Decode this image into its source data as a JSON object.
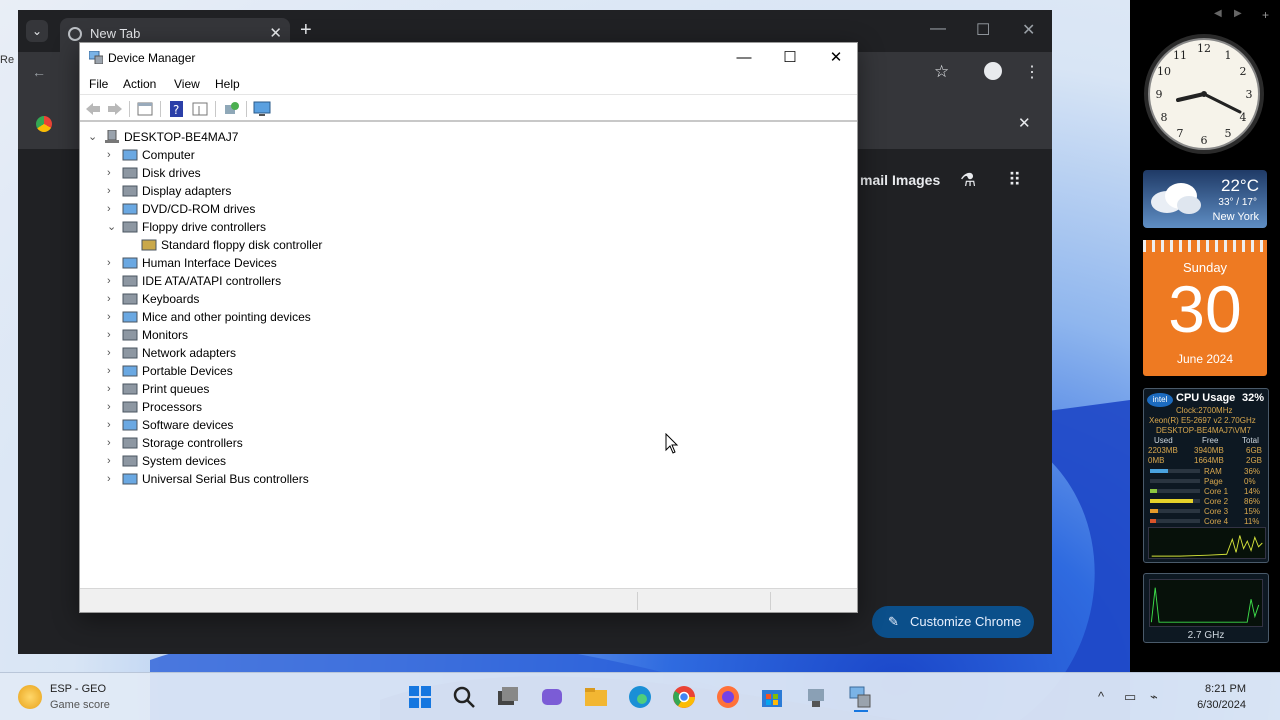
{
  "chrome": {
    "tab_title": "New Tab",
    "tab_close": "✕",
    "new_tab": "+",
    "ntp_links": [
      "mail",
      "Images"
    ],
    "customize_label": "Customize Chrome"
  },
  "device_manager": {
    "title": "Device Manager",
    "menu": [
      "File",
      "Action",
      "View",
      "Help"
    ],
    "root": "DESKTOP-BE4MAJ7",
    "tree": [
      {
        "label": "Computer",
        "expanded": false
      },
      {
        "label": "Disk drives",
        "expanded": false
      },
      {
        "label": "Display adapters",
        "expanded": false
      },
      {
        "label": "DVD/CD-ROM drives",
        "expanded": false
      },
      {
        "label": "Floppy drive controllers",
        "expanded": true
      },
      {
        "label": "Standard floppy disk controller",
        "child": true
      },
      {
        "label": "Human Interface Devices",
        "expanded": false
      },
      {
        "label": "IDE ATA/ATAPI controllers",
        "expanded": false
      },
      {
        "label": "Keyboards",
        "expanded": false
      },
      {
        "label": "Mice and other pointing devices",
        "expanded": false
      },
      {
        "label": "Monitors",
        "expanded": false
      },
      {
        "label": "Network adapters",
        "expanded": false
      },
      {
        "label": "Portable Devices",
        "expanded": false
      },
      {
        "label": "Print queues",
        "expanded": false
      },
      {
        "label": "Processors",
        "expanded": false
      },
      {
        "label": "Software devices",
        "expanded": false
      },
      {
        "label": "Storage controllers",
        "expanded": false
      },
      {
        "label": "System devices",
        "expanded": false
      },
      {
        "label": "Universal Serial Bus controllers",
        "expanded": false
      }
    ]
  },
  "gadgets": {
    "weather": {
      "temp": "22°C",
      "range": "33° / 17°",
      "city": "New York"
    },
    "calendar": {
      "weekday": "Sunday",
      "day": "30",
      "month": "June 2024"
    },
    "cpu": {
      "title": "CPU Usage",
      "percent": "32%",
      "clock": "Clock:2700MHz",
      "model": "Xeon(R) E5-2697 v2 2.70GHz",
      "host": "DESKTOP-BE4MAJ7\\VM7",
      "headers": [
        "Used",
        "Free",
        "Total"
      ],
      "ram_row": [
        "2203MB",
        "3940MB",
        "6GB"
      ],
      "page_row": [
        "0MB",
        "1664MB",
        "2GB"
      ],
      "meters": [
        {
          "name": "RAM",
          "pct": "36%",
          "level": 0.36
        },
        {
          "name": "Page",
          "pct": "0%",
          "level": 0.0
        },
        {
          "name": "Core 1",
          "pct": "14%",
          "level": 0.14
        },
        {
          "name": "Core 2",
          "pct": "86%",
          "level": 0.86
        },
        {
          "name": "Core 3",
          "pct": "15%",
          "level": 0.15
        },
        {
          "name": "Core 4",
          "pct": "11%",
          "level": 0.11
        }
      ]
    },
    "ghz": "2.7 GHz"
  },
  "taskbar": {
    "weather_line1": "ESP - GEO",
    "weather_line2": "Game score",
    "time": "8:21 PM",
    "date": "6/30/2024"
  },
  "colors": {
    "accent": "#0b4f8a",
    "calendar": "#ee7a22",
    "chrome_bg": "#202124"
  }
}
